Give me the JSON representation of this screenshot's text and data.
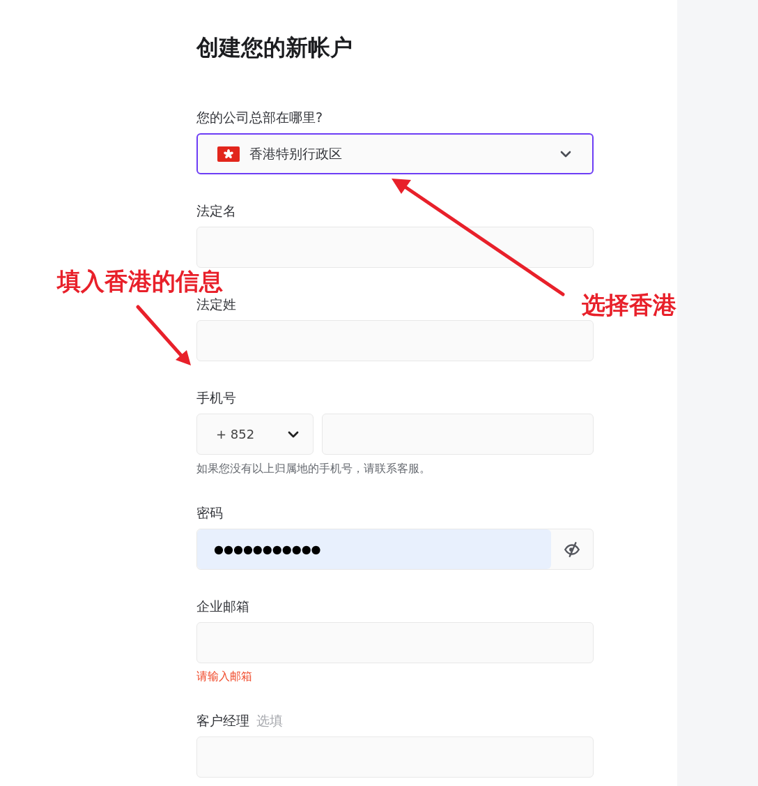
{
  "title": "创建您的新帐户",
  "fields": [
    {
      "kind": "country",
      "label": "您的公司总部在哪里?",
      "value": "香港特别行政区",
      "focused": true
    },
    {
      "kind": "text",
      "label": "法定名"
    },
    {
      "kind": "text",
      "label": "法定姓"
    },
    {
      "kind": "phone",
      "label": "手机号",
      "code": "+ 852",
      "help": "如果您没有以上归属地的手机号，请联系客服。"
    },
    {
      "kind": "password",
      "label": "密码",
      "value": "●●●●●●●●●●●",
      "autofilled": true
    },
    {
      "kind": "text",
      "label": "企业邮箱",
      "error": "请输入邮箱"
    },
    {
      "kind": "text",
      "label": "客户经理",
      "optional": "选填"
    }
  ],
  "annotations": [
    {
      "kind": "left",
      "text": "填入香港的信息"
    },
    {
      "kind": "right",
      "text": "选择香港"
    }
  ]
}
